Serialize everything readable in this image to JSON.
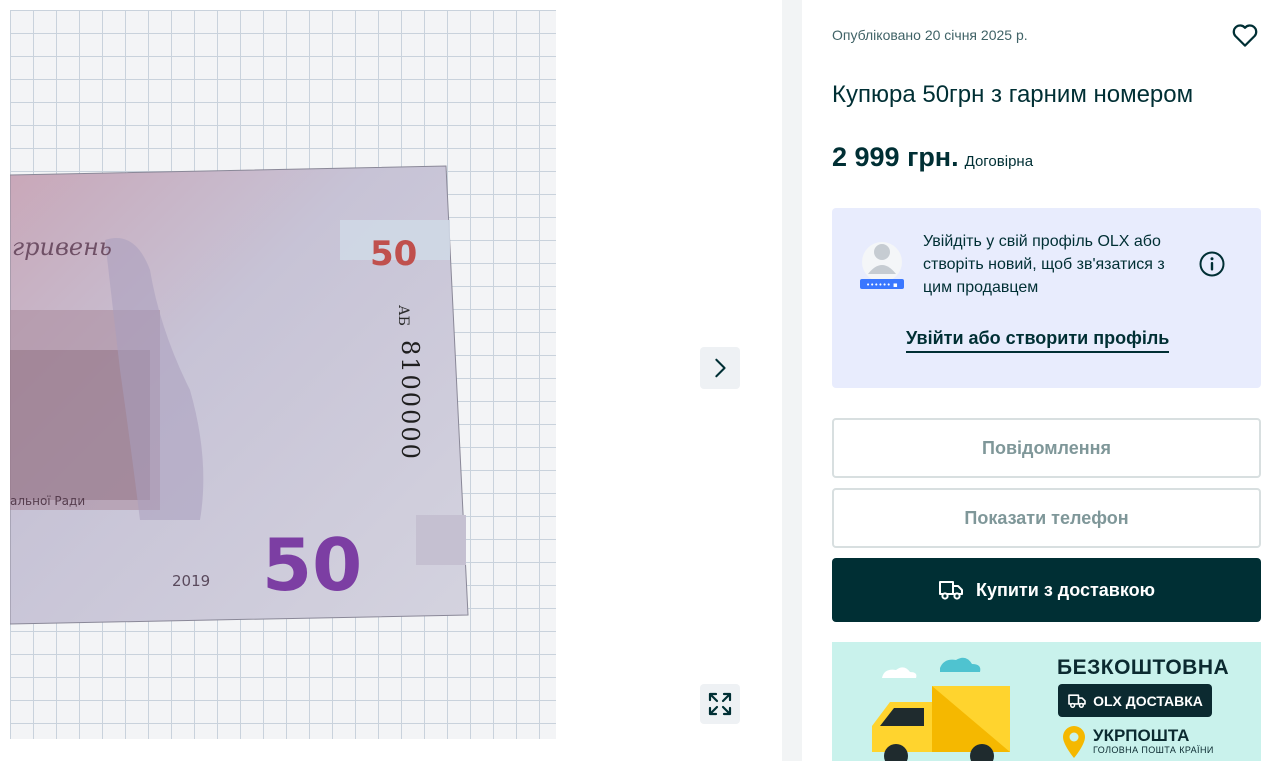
{
  "gallery": {
    "photo_alt": "",
    "note_year": "2019",
    "note_denomination": "50",
    "note_serial_series": "АБ",
    "note_serial_number": "8100000",
    "note_script_text": "гривень",
    "note_corner_text": "альної Ради"
  },
  "listing": {
    "posted": "Опубліковано 20 січня 2025 р.",
    "title": "Купюра 50грн з гарним номером",
    "price": "2 999 грн.",
    "negotiable": "Договірна"
  },
  "login_prompt": {
    "text": "Увійдіть у свій профіль OLX або створіть новий, щоб зв'язатися з цим продавцем",
    "link_label": "Увійти або створити профіль"
  },
  "actions": {
    "message_label": "Повідомлення",
    "phone_label": "Показати телефон",
    "buy_label": "Купити з доставкою"
  },
  "banner": {
    "free_label": "БЕЗКОШТОВНА",
    "delivery_label": "OLX ДОСТАВКА",
    "carrier_name": "УКРПОШТА",
    "carrier_slogan": "ГОЛОВНА ПОШТА КРАЇНИ"
  },
  "icons": {
    "next": "chevron-right-icon",
    "fullscreen": "expand-icon",
    "favorite": "heart-icon",
    "info": "info-icon",
    "truck": "truck-icon"
  },
  "colors": {
    "brand_dark": "#002f34",
    "login_bg": "#e8ecfd",
    "banner_bg": "#c9f2ec"
  }
}
